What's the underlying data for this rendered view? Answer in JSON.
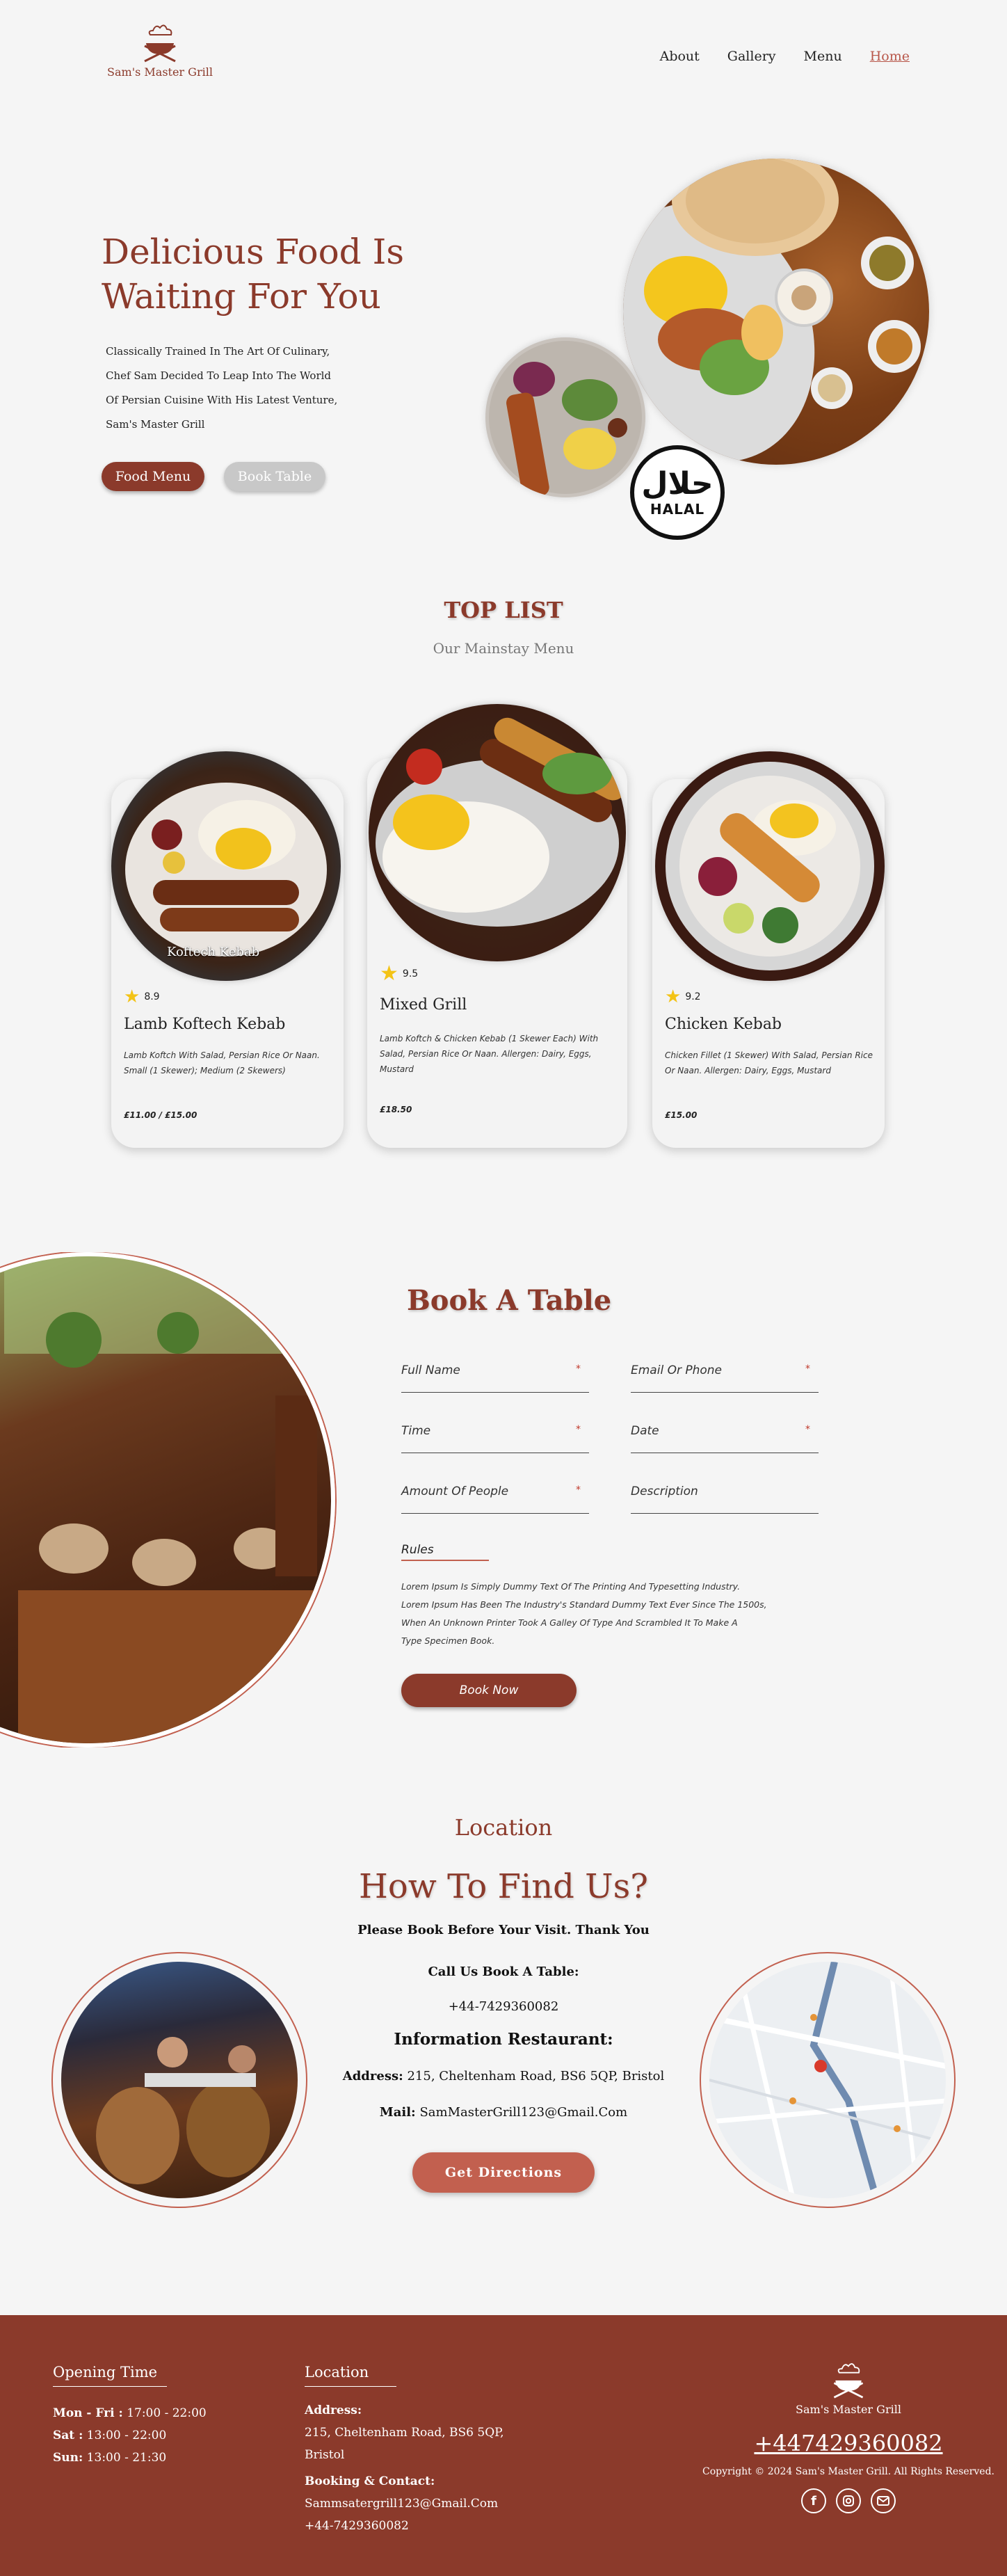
{
  "header": {
    "logo_text": "Sam's Master Grill",
    "nav": [
      "About",
      "Gallery",
      "Menu",
      "Home"
    ]
  },
  "hero": {
    "title_line1": "Delicious Food Is",
    "title_line2": "Waiting For You",
    "desc_lines": [
      "Classically Trained In The Art Of Culinary,",
      "Chef Sam Decided To Leap Into The World",
      "Of Persian Cuisine With His Latest Venture,",
      "Sam's Master Grill"
    ],
    "btn_food_menu": "Food Menu",
    "btn_book_table": "Book Table",
    "halal_arabic": "حلال",
    "halal_text": "HALAL"
  },
  "top_list": {
    "title": "TOP LIST",
    "subtitle": "Our Mainstay Menu",
    "cards": [
      {
        "image_caption": "Koftech Kebab",
        "rating": "8.9",
        "name": "Lamb Koftech Kebab",
        "desc_lines": [
          "Lamb Koftch With Salad, Persian Rice Or Naan.",
          "Small (1 Skewer); Medium (2 Skewers)"
        ],
        "price": "£11.00 / £15.00"
      },
      {
        "image_caption": "",
        "rating": "9.5",
        "name": "Mixed Grill",
        "desc_lines": [
          "Lamb Koftch & Chicken Kebab (1 Skewer Each) With",
          "Salad, Persian Rice Or Naan. Allergen: Dairy, Eggs,",
          "Mustard"
        ],
        "price": "£18.50"
      },
      {
        "image_caption": "",
        "rating": "9.2",
        "name": "Chicken Kebab",
        "desc_lines": [
          "Chicken Fillet (1 Skewer) With Salad, Persian Rice",
          "Or Naan. Allergen: Dairy, Eggs, Mustard"
        ],
        "price": "£15.00"
      }
    ]
  },
  "booking": {
    "title": "Book A Table",
    "fields": {
      "full_name": "Full Name",
      "email_phone": "Email Or Phone",
      "time": "Time",
      "date": "Date",
      "people": "Amount Of People",
      "description": "Description"
    },
    "required_mark": "*",
    "rules_label": "Rules",
    "rules_lines": [
      "Lorem Ipsum Is Simply Dummy Text Of The Printing And Typesetting Industry.",
      "Lorem Ipsum Has Been The Industry's Standard Dummy Text Ever Since The 1500s,",
      "When An Unknown Printer Took A Galley Of Type And Scrambled It To Make A",
      "Type Specimen Book."
    ],
    "btn_book_now": "Book Now"
  },
  "location": {
    "label": "Location",
    "title": "How To Find Us?",
    "please_book": "Please Book Before Your Visit. Thank You",
    "call_label": "Call Us Book A Table:",
    "phone": "+44-7429360082",
    "info_label": "Information Restaurant:",
    "address_label": "Address:",
    "address": "215, Cheltenham Road, BS6 5QP, Bristol",
    "mail_label": "Mail:",
    "mail": "SamMasterGrill123@Gmail.Com",
    "btn_directions": "Get Directions"
  },
  "footer": {
    "opening_title": "Opening Time",
    "hours": [
      {
        "days": "Mon - Fri :",
        "time": " 17:00 - 22:00"
      },
      {
        "days": "Sat :",
        "time": " 13:00 - 22:00"
      },
      {
        "days": "Sun:",
        "time": " 13:00 - 21:30"
      }
    ],
    "location_title": "Location",
    "address_label": "Address:",
    "address_line1": "215, Cheltenham Road, BS6 5QP,",
    "address_line2": "Bristol",
    "booking_label": "Booking & Contact:",
    "email": "Sammsatergrill123@Gmail.Com",
    "phone": "+44-7429360082",
    "logo_text": "Sam's Master Grill",
    "big_phone": "+447429360082",
    "copyright": "Copyright © 2024 Sam's Master Grill. All Rights Reserved."
  },
  "colors": {
    "brand": "#8b3a2b",
    "accent": "#c2604f",
    "background": "#f5f5f5"
  },
  "icons": [
    "chef-logo-icon",
    "star-icon",
    "facebook-icon",
    "instagram-icon",
    "email-icon"
  ]
}
